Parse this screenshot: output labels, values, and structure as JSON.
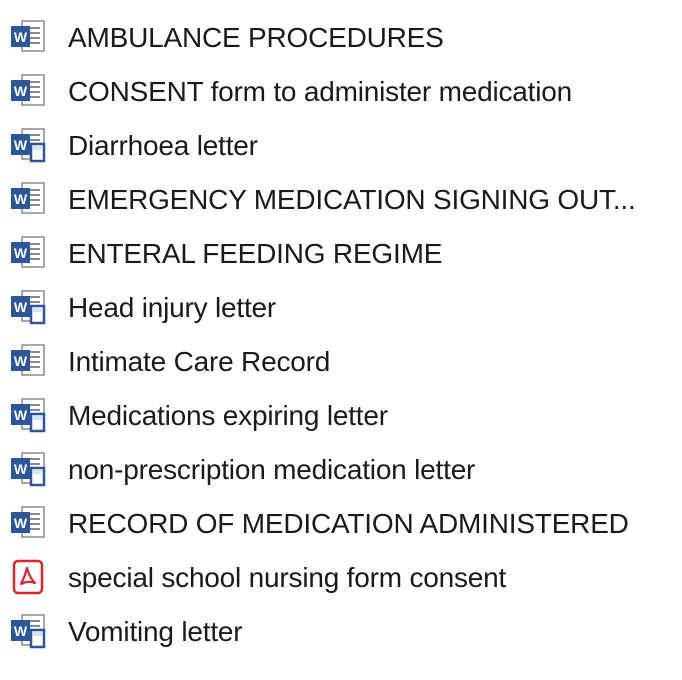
{
  "files": [
    {
      "name": "AMBULANCE PROCEDURES",
      "icon": "word-document-icon"
    },
    {
      "name": "CONSENT form to administer medication",
      "icon": "word-document-icon"
    },
    {
      "name": "Diarrhoea letter",
      "icon": "word-compatibility-document-icon"
    },
    {
      "name": "EMERGENCY MEDICATION SIGNING OUT...",
      "icon": "word-document-icon"
    },
    {
      "name": "ENTERAL FEEDING REGIME",
      "icon": "word-document-icon"
    },
    {
      "name": "Head injury letter",
      "icon": "word-compatibility-document-icon"
    },
    {
      "name": "Intimate Care Record",
      "icon": "word-document-icon"
    },
    {
      "name": "Medications expiring letter",
      "icon": "word-compatibility-document-icon"
    },
    {
      "name": "non-prescription medication letter",
      "icon": "word-compatibility-document-icon"
    },
    {
      "name": "RECORD OF MEDICATION ADMINISTERED",
      "icon": "word-document-icon"
    },
    {
      "name": "special school nursing form consent",
      "icon": "pdf-document-icon"
    },
    {
      "name": "Vomiting letter",
      "icon": "word-compatibility-document-icon"
    }
  ],
  "colors": {
    "word_blue": "#2b579a",
    "word_light": "#d6e4f5",
    "pdf_red": "#d9262c",
    "text": "#1a1a1a"
  }
}
